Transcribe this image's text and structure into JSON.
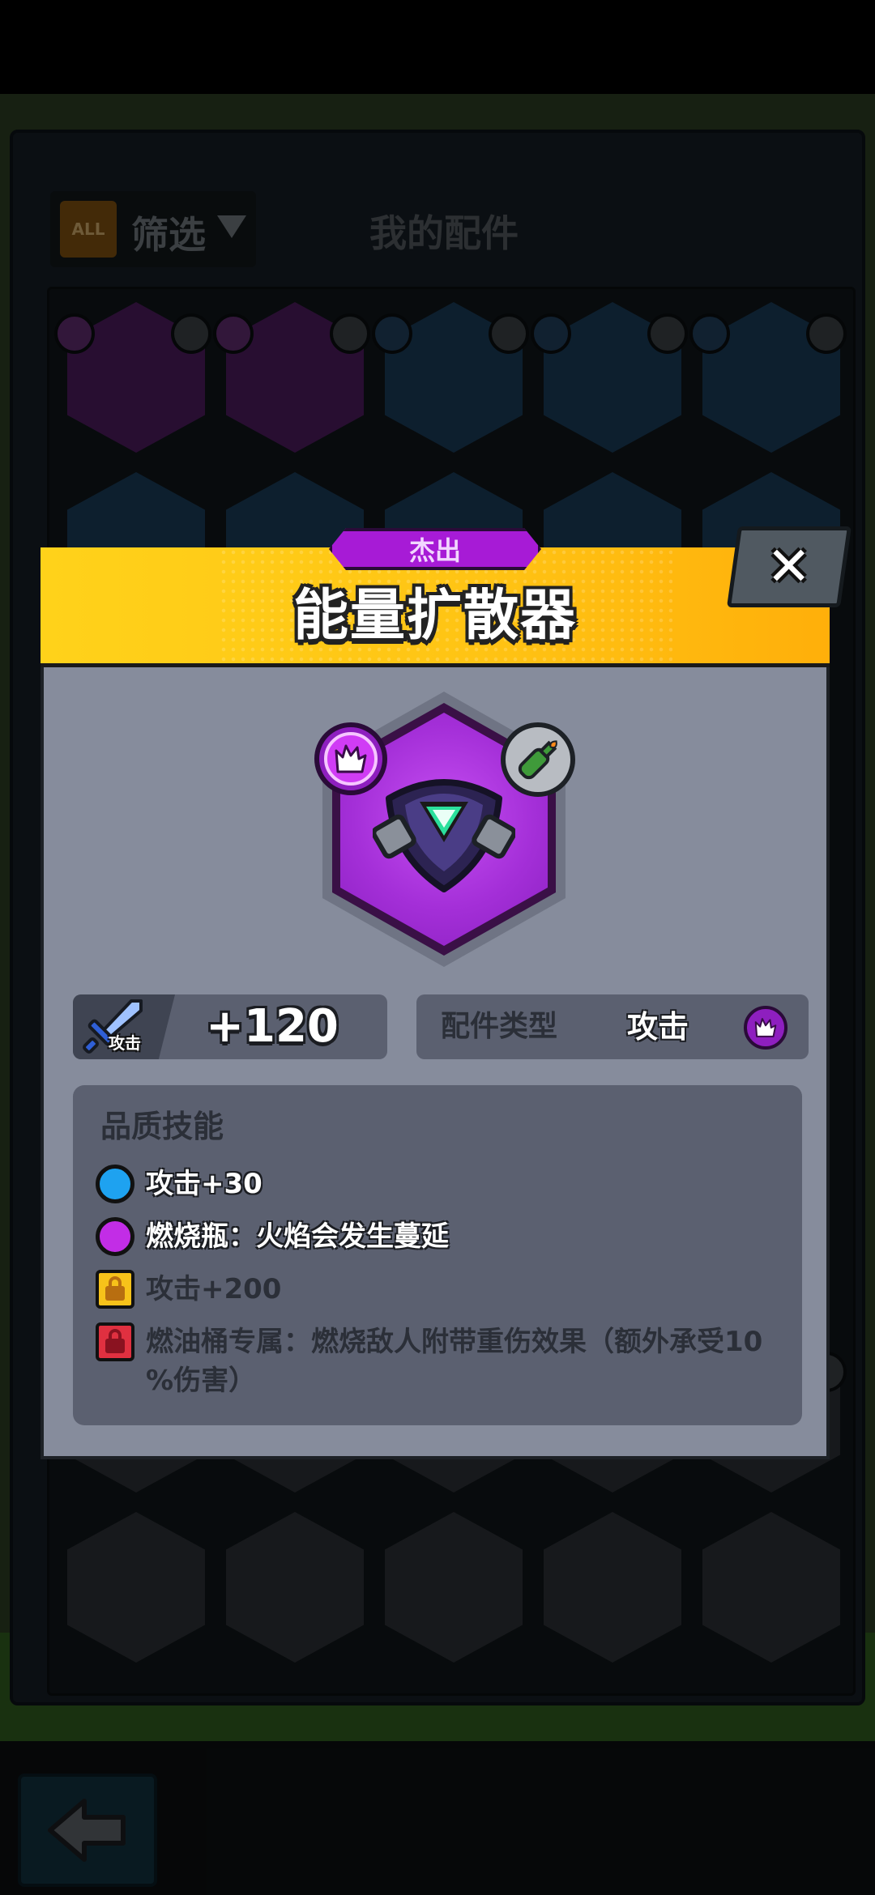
{
  "background": {
    "filter": {
      "all_badge": "ALL",
      "label": "筛选"
    },
    "title": "我的配件"
  },
  "modal": {
    "rarity": "杰出",
    "title": "能量扩散器",
    "close_label": "✕",
    "item": {
      "type_badge_icon": "attack-type-icon",
      "weapon_badge_icon": "molotov-bottle-icon"
    },
    "stat": {
      "icon_label": "攻击",
      "value": "+120"
    },
    "type": {
      "label": "配件类型",
      "value": "攻击"
    },
    "skills": {
      "title": "品质技能",
      "items": [
        {
          "mark": "blue-dot",
          "text": "攻击+30",
          "unlocked": true
        },
        {
          "mark": "purple-dot",
          "text": "燃烧瓶：火焰会发生蔓延",
          "unlocked": true
        },
        {
          "mark": "yellow-lock",
          "text": "攻击+200",
          "unlocked": false
        },
        {
          "mark": "red-lock",
          "text_line1": "燃油桶专属：燃烧敌人附带重伤效果（额外承受10",
          "text_line2": "%伤害）",
          "unlocked": false
        }
      ]
    }
  },
  "colors": {
    "header_yellow": "#ffc414",
    "rarity_purple": "#a71bd6",
    "body_gray": "#868c9c",
    "panel_gray": "#5b6070",
    "skill_blue": "#1ea2f0",
    "skill_purple": "#c22de6",
    "lock_yellow": "#f7c21a",
    "lock_red": "#e03040"
  }
}
